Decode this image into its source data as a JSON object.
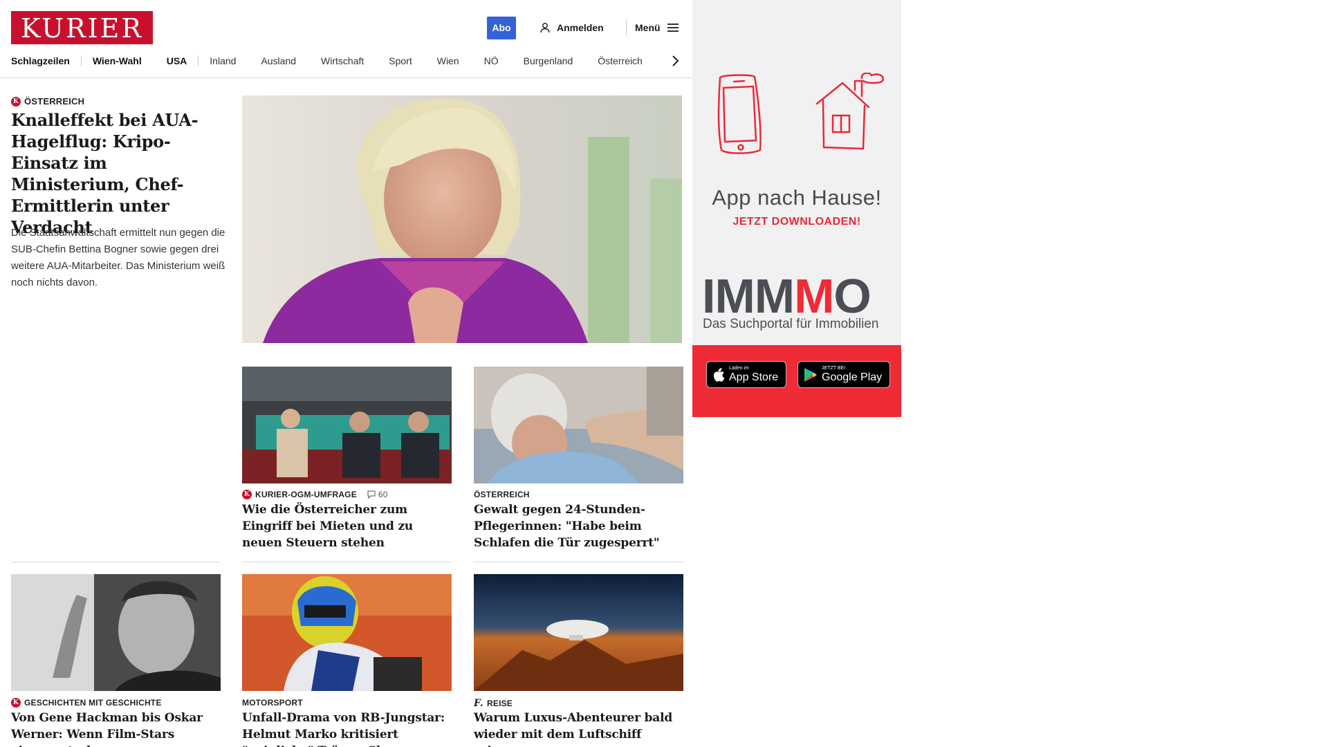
{
  "header": {
    "logo": "KURIER",
    "abo_label": "Abo",
    "login_label": "Anmelden",
    "menu_label": "Menü"
  },
  "nav": {
    "items": [
      "Schlagzeilen",
      "Wien-Wahl",
      "USA",
      "Inland",
      "Ausland",
      "Wirtschaft",
      "Sport",
      "Wien",
      "NÖ",
      "Burgenland",
      "Österreich"
    ]
  },
  "lead": {
    "category": "ÖSTERREICH",
    "title": "Knalleffekt bei AUA-Hagelflug: Kripo-Einsatz im Ministerium, Chef-Ermittlerin unter Verdacht",
    "text": "Die Staatsanwaltschaft ermittelt nun gegen die SUB-Chefin Bettina Bogner sowie gegen drei weitere AUA-Mitarbeiter. Das Ministerium weiß noch nichts davon."
  },
  "cards": [
    {
      "category": "KURIER-OGM-UMFRAGE",
      "comments": "60",
      "title": "Wie die Österreicher zum Eingriff bei Mieten und zu neuen Steuern stehen"
    },
    {
      "category": "ÖSTERREICH",
      "title": "Gewalt gegen 24-Stunden-Pflegerinnen: \"Habe beim Schlafen die Tür zugesperrt\""
    },
    {
      "category": "GESCHICHTEN MIT GESCHICHTE",
      "title": "Von Gene Hackman bis Oskar Werner: Wenn Film-Stars einsam sterben"
    },
    {
      "category": "MOTORSPORT",
      "title": "Unfall-Drama von RB-Jungstar: Helmut Marko kritisiert \"peinliche\" Tränen-Show"
    },
    {
      "category": "REISE",
      "title": "Warum Luxus-Abenteurer bald wieder mit dem Luftschiff reisen"
    }
  ],
  "ad": {
    "title": "App nach Hause!",
    "subtitle": "JETZT DOWNLOADEN!",
    "brand_a": "IMM",
    "brand_m": "M",
    "brand_o": "O",
    "brand_sub": "Das Suchportal für Immobilien",
    "appstore_small": "Laden im",
    "appstore_big": "App Store",
    "googleplay_small": "JETZT BEI",
    "googleplay_big": "Google Play"
  },
  "colors": {
    "brand_red": "#c8102e",
    "abo_blue": "#3262d6",
    "ad_red": "#ef2b35"
  }
}
